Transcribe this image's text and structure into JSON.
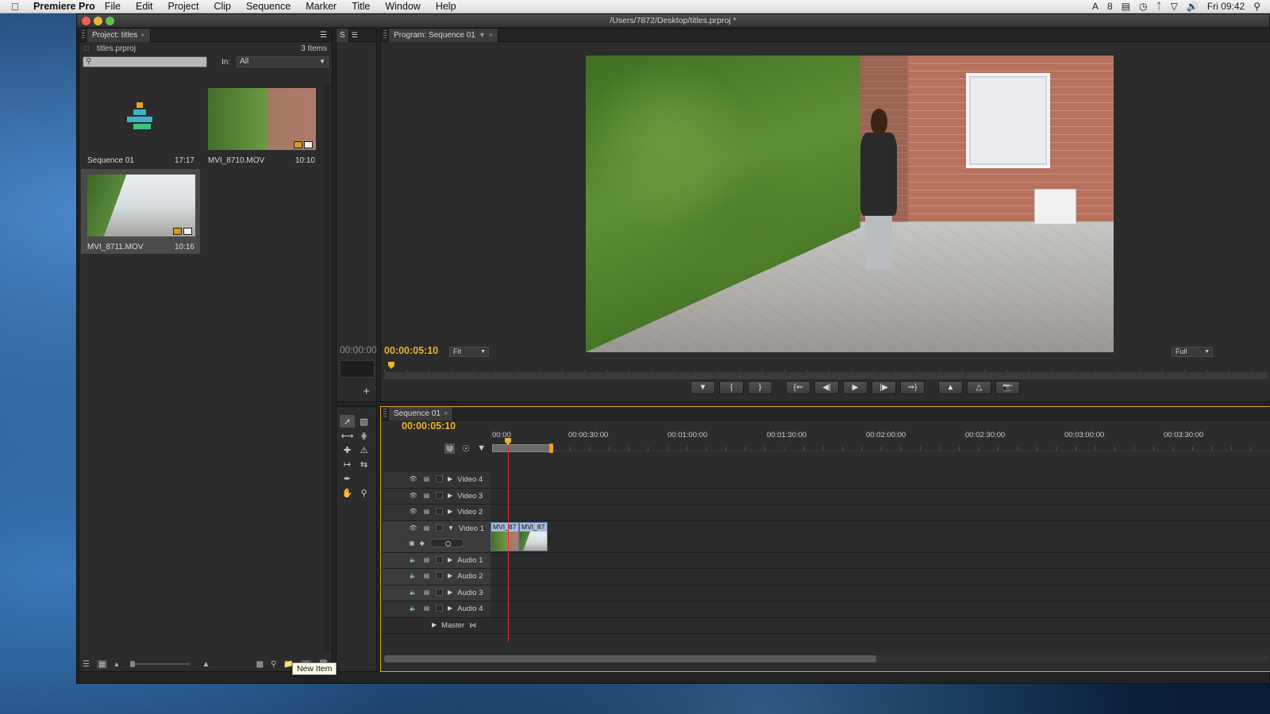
{
  "menubar": {
    "apple_icon": "apple-icon",
    "app_name": "Premiere Pro",
    "items": [
      "File",
      "Edit",
      "Project",
      "Clip",
      "Sequence",
      "Marker",
      "Title",
      "Window",
      "Help"
    ],
    "status": {
      "adobe_count": "8",
      "clock": "Fri 09:42"
    }
  },
  "window": {
    "title": "/Users/7872/Desktop/titles.prproj *",
    "traffic_lights": {
      "close": "#ec5f57",
      "minimize": "#e2b93c",
      "zoom": "#5fc454"
    }
  },
  "project_panel": {
    "tab_label": "Project: titles",
    "project_file": "titles.prproj",
    "item_count": "3 Items",
    "search_placeholder": "",
    "in_label": "In:",
    "in_value": "All",
    "items": [
      {
        "name": "Sequence 01",
        "duration": "17:17"
      },
      {
        "name": "MVI_8710.MOV",
        "duration": "10:10"
      },
      {
        "name": "MVI_8711.MOV",
        "duration": "10:16"
      }
    ]
  },
  "source_panel": {
    "tab_label": "S",
    "timecode": "00:00:00"
  },
  "program_panel": {
    "tab_label": "Program: Sequence 01",
    "timecode": "00:00:05:10",
    "zoom": "Fit",
    "resolution": "Full"
  },
  "timeline_panel": {
    "tab_label": "Sequence 01",
    "timecode": "00:00:05:10",
    "ruler": [
      "00:00",
      "00:00:30:00",
      "00:01:00:00",
      "00:01:30:00",
      "00:02:00:00",
      "00:02:30:00",
      "00:03:00:00",
      "00:03:30:00"
    ],
    "tracks": {
      "video": [
        "Video 4",
        "Video 3",
        "Video 2",
        "Video 1"
      ],
      "audio": [
        "Audio 1",
        "Audio 2",
        "Audio 3",
        "Audio 4"
      ],
      "master": "Master"
    },
    "clips": [
      "MVI_87",
      "MVI_87"
    ]
  },
  "tooltip": "New Item",
  "colors": {
    "timecode": "#e8b22e",
    "playhead_line": "#d23a2a",
    "active_panel_border": "#e8a123"
  }
}
